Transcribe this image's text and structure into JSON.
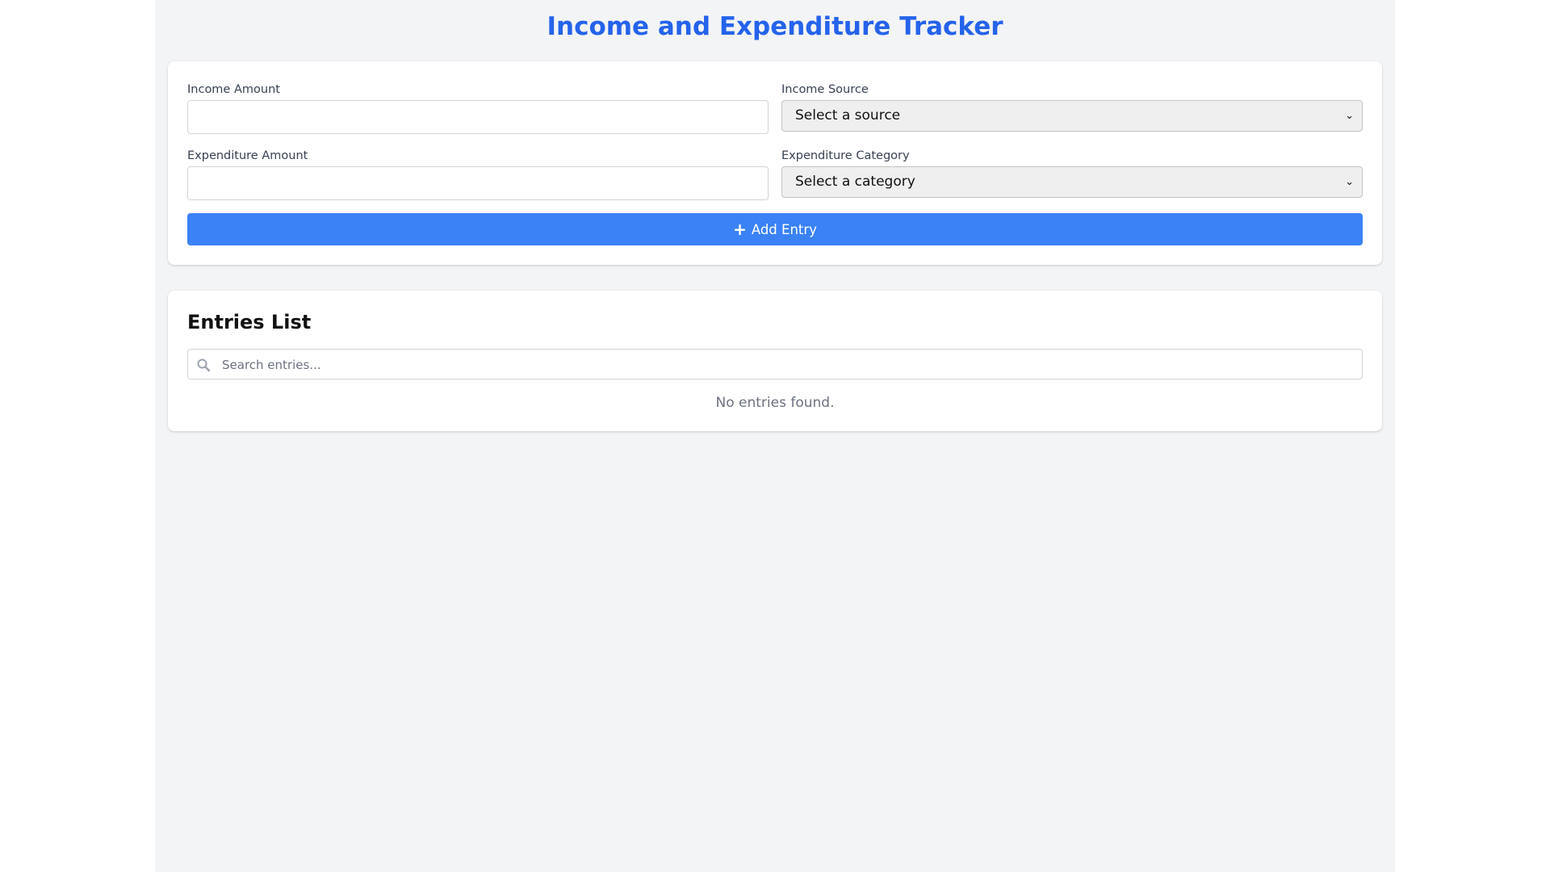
{
  "header": {
    "title": "Income and Expenditure Tracker"
  },
  "form": {
    "income_amount_label": "Income Amount",
    "income_amount_value": "",
    "income_source_label": "Income Source",
    "income_source_selected": "Select a source",
    "expenditure_amount_label": "Expenditure Amount",
    "expenditure_amount_value": "",
    "expenditure_category_label": "Expenditure Category",
    "expenditure_category_selected": "Select a category",
    "add_button_label": "Add Entry",
    "add_button_icon": "plus-icon"
  },
  "entries": {
    "title": "Entries List",
    "search_placeholder": "Search entries...",
    "search_icon": "search-icon",
    "empty_message": "No entries found."
  },
  "colors": {
    "accent": "#3b82f6",
    "title": "#2563eb",
    "background": "#f3f4f6"
  }
}
